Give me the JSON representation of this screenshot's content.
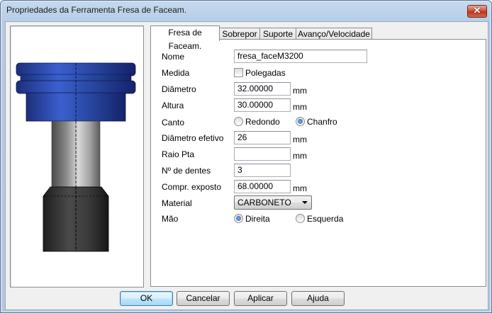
{
  "window": {
    "title": "Propriedades da Ferramenta Fresa de Faceam.",
    "close_symbol": "✕"
  },
  "tabs": [
    {
      "label": "Fresa de Faceam.",
      "active": true
    },
    {
      "label": "Sobrepor",
      "active": false
    },
    {
      "label": "Suporte",
      "active": false
    },
    {
      "label": "Avanço/Velocidade",
      "active": false
    }
  ],
  "form": {
    "nome": {
      "label": "Nome",
      "value": "fresa_faceM3200"
    },
    "medida": {
      "label": "Medida",
      "checkbox_label": "Polegadas",
      "checked": false
    },
    "diametro": {
      "label": "Diâmetro",
      "value": "32.00000",
      "unit": "mm"
    },
    "altura": {
      "label": "Altura",
      "value": "30.00000",
      "unit": "mm"
    },
    "canto": {
      "label": "Canto",
      "option1": "Redondo",
      "option2": "Chanfro",
      "selected": "Chanfro"
    },
    "diametro_efetivo": {
      "label": "Diâmetro efetivo",
      "value": "26",
      "unit": "mm"
    },
    "raio_pta": {
      "label": "Raio Pta",
      "value": "",
      "unit": "mm"
    },
    "n_dentes": {
      "label": "Nº de dentes",
      "value": "3"
    },
    "compr_exposto": {
      "label": "Compr. exposto",
      "value": "68.00000",
      "unit": "mm"
    },
    "material": {
      "label": "Material",
      "selected": "CARBONETO"
    },
    "mao": {
      "label": "Mão",
      "option1": "Direita",
      "option2": "Esquerda",
      "selected": "Direita"
    }
  },
  "buttons": {
    "ok": "OK",
    "cancel": "Cancelar",
    "apply": "Aplicar",
    "help": "Ajuda"
  },
  "colors": {
    "tool_head": "#2a4aa6",
    "tool_shank": "#8c8c8c",
    "tool_holder": "#3a3a3a",
    "title_bar": "#c5d9ef"
  }
}
